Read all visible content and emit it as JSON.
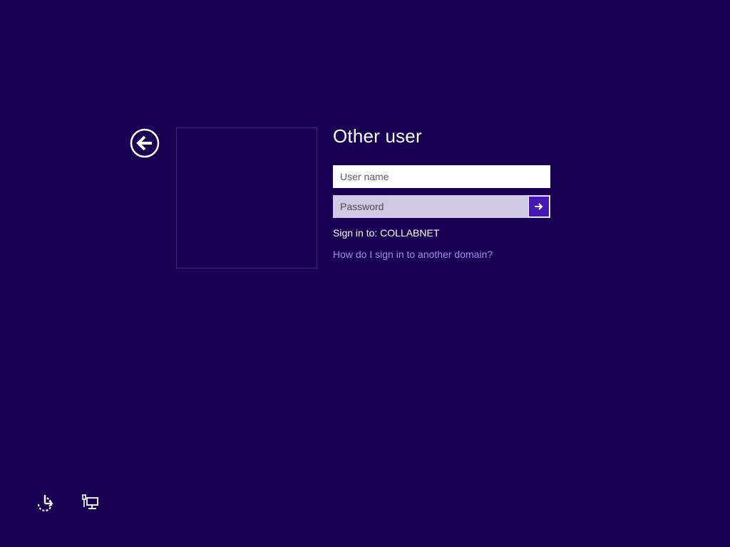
{
  "header": {
    "title": "Other user"
  },
  "form": {
    "username_placeholder": "User name",
    "password_placeholder": "Password",
    "sign_in_to": "Sign in to: COLLABNET",
    "help_link": "How do I sign in to another domain?"
  },
  "icons": {
    "back": "back-arrow-circle-icon",
    "submit": "arrow-right-icon",
    "ease_of_access": "ease-of-access-icon",
    "network": "network-icon"
  },
  "colors": {
    "background": "#180052",
    "accent": "#4617b4",
    "link": "#a08cf0",
    "password_field": "#cfc9e3"
  }
}
